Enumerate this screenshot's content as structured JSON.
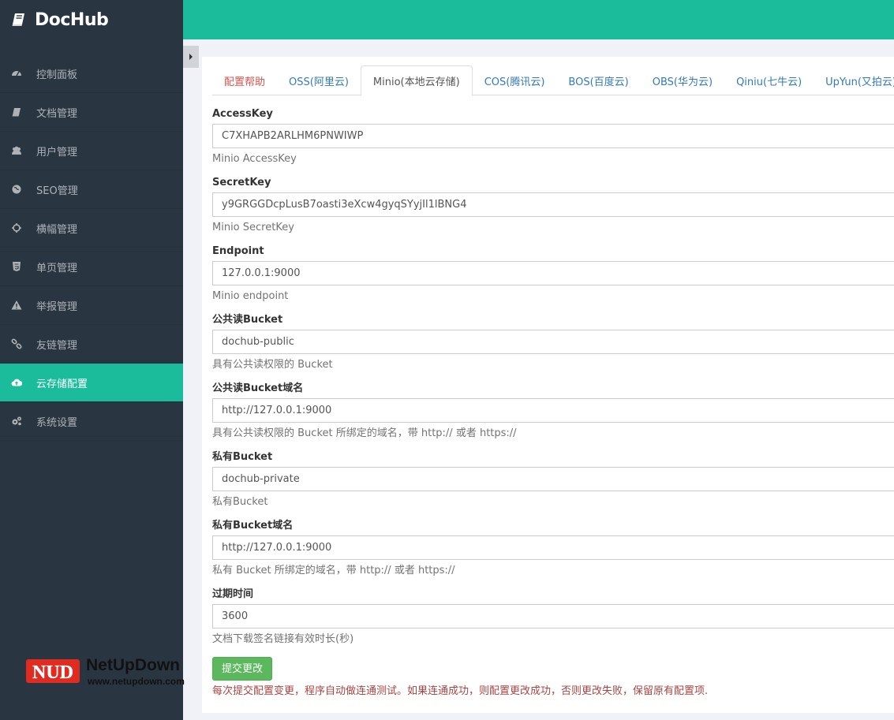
{
  "brand": {
    "name": "DocHub",
    "icon": "book-icon"
  },
  "sidebar": {
    "items": [
      {
        "label": "控制面板",
        "icon": "dashboard-icon"
      },
      {
        "label": "文档管理",
        "icon": "book-icon"
      },
      {
        "label": "用户管理",
        "icon": "users-icon"
      },
      {
        "label": "SEO管理",
        "icon": "globe-icon"
      },
      {
        "label": "横幅管理",
        "icon": "crosshair-icon"
      },
      {
        "label": "单页管理",
        "icon": "html5-icon"
      },
      {
        "label": "举报管理",
        "icon": "warning-icon"
      },
      {
        "label": "友链管理",
        "icon": "link-icon"
      },
      {
        "label": "云存储配置",
        "icon": "cloud-upload-icon",
        "active": true
      },
      {
        "label": "系统设置",
        "icon": "gears-icon"
      }
    ]
  },
  "tabs": [
    {
      "label": "配置帮助"
    },
    {
      "label": "OSS(阿里云)"
    },
    {
      "label": "Minio(本地云存储)",
      "active": true
    },
    {
      "label": "COS(腾讯云)"
    },
    {
      "label": "BOS(百度云)"
    },
    {
      "label": "OBS(华为云)"
    },
    {
      "label": "Qiniu(七牛云)"
    },
    {
      "label": "UpYun(又拍云)"
    }
  ],
  "form": {
    "fields": [
      {
        "label": "AccessKey",
        "value": "C7XHAPB2ARLHM6PNWIWP",
        "help": "Minio AccessKey"
      },
      {
        "label": "SecretKey",
        "value": "y9GRGGDcpLusB7oasti3eXcw4gyqSYyjIl1lBNG4",
        "help": "Minio SecretKey"
      },
      {
        "label": "Endpoint",
        "value": "127.0.0.1:9000",
        "help": "Minio endpoint"
      },
      {
        "label": "公共读Bucket",
        "value": "dochub-public",
        "help": "具有公共读权限的 Bucket"
      },
      {
        "label": "公共读Bucket域名",
        "value": "http://127.0.0.1:9000",
        "help": "具有公共读权限的 Bucket 所绑定的域名，带 http:// 或者 https://"
      },
      {
        "label": "私有Bucket",
        "value": "dochub-private",
        "help": "私有Bucket"
      },
      {
        "label": "私有Bucket域名",
        "value": "http://127.0.0.1:9000",
        "help": "私有 Bucket 所绑定的域名，带 http:// 或者 https://"
      },
      {
        "label": "过期时间",
        "value": "3600",
        "help": "文档下载签名链接有效时长(秒)"
      }
    ],
    "submit_label": "提交更改",
    "note": "每次提交配置变更，程序自动做连通测试。如果连通成功，则配置更改成功，否则更改失败，保留原有配置项."
  },
  "watermark": {
    "badge": "NUD",
    "name": "NetUpDown",
    "url": "www.netupdown.com"
  },
  "colors": {
    "sidebar": "#2a3542",
    "accent": "#1abc9c",
    "submit": "#5cb85c",
    "note": "#a94442"
  }
}
